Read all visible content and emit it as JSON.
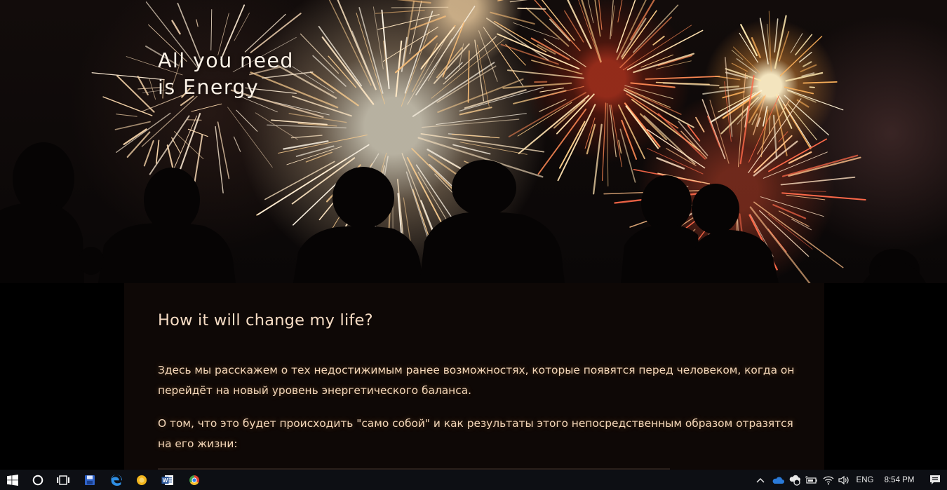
{
  "hero": {
    "title": "All you need\nis Energy"
  },
  "content": {
    "heading": "How it will change my life?",
    "paragraphs": [
      "Здесь мы расскажем о тех недостижимым ранее возможностях, которые появятся перед человеком, когда он перейдёт на новый уровень энергетического баланса.",
      "О том, что это будет происходить \"само собой\" и как результаты этого непосредственным образом отразятся на его жизни:"
    ]
  },
  "colors": {
    "heading": "#f6dcc4",
    "body_text": "#f4d7b9",
    "content_bg": "#0e0806",
    "taskbar_bg": "#0d0f14"
  },
  "taskbar": {
    "pinned": [
      "windows-start-icon",
      "cortana-icon",
      "task-view-icon",
      "save-app-icon",
      "edge-icon",
      "sticky-app-icon",
      "word-icon",
      "chrome-icon"
    ],
    "tray": {
      "icons": [
        "show-hidden-icons-chevron",
        "onedrive-icon",
        "network-sync-icon",
        "battery-icon",
        "wifi-icon",
        "volume-icon"
      ],
      "language": "ENG",
      "time": "8:54 PM"
    }
  }
}
